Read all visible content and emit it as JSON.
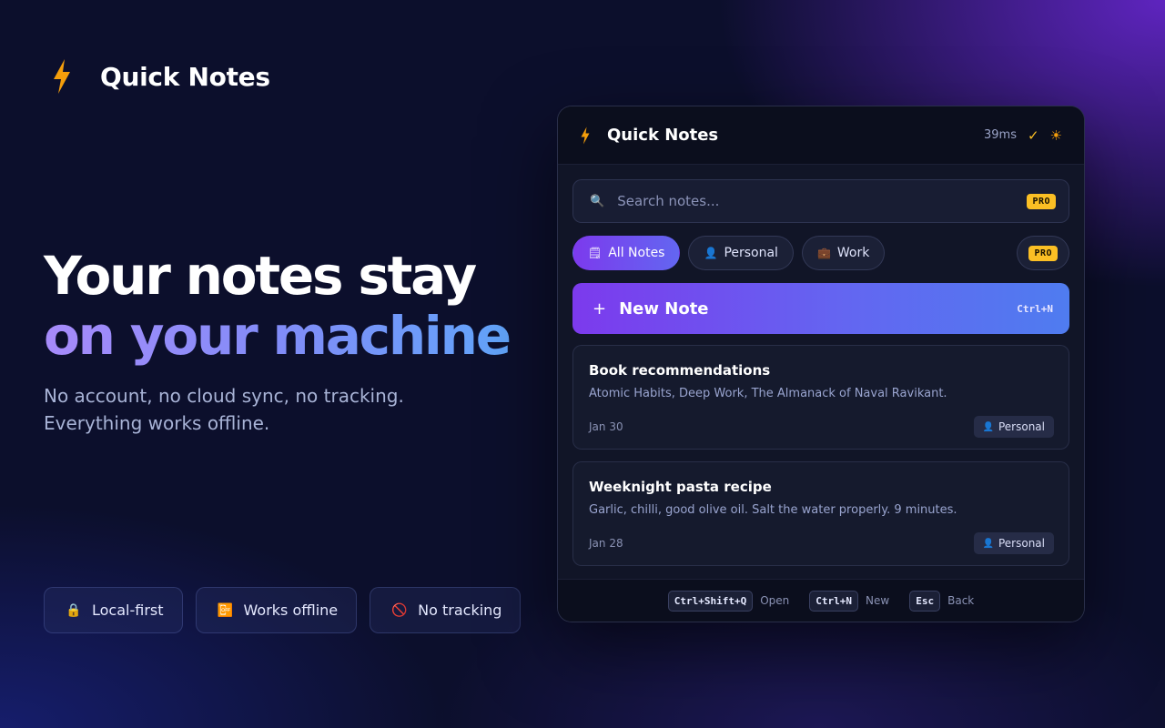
{
  "brand": {
    "name": "Quick Notes",
    "icon": "lightning-bolt-icon"
  },
  "hero": {
    "line1": "Your notes stay",
    "line2": "on your machine",
    "subtitle": "No account, no cloud sync, no tracking. Everything works offline."
  },
  "features": [
    {
      "icon": "lock-icon",
      "glyph": "🔒",
      "label": "Local-first"
    },
    {
      "icon": "offline-icon",
      "glyph": "📴",
      "label": "Works offline"
    },
    {
      "icon": "no-entry-icon",
      "glyph": "🚫",
      "label": "No tracking"
    }
  ],
  "app": {
    "title": "Quick Notes",
    "latency": "39ms",
    "check_glyph": "✓",
    "theme_glyph": "☀",
    "search": {
      "placeholder": "Search notes...",
      "badge": "PRO"
    },
    "filters": [
      {
        "glyph": "🗒",
        "label": "All Notes",
        "active": true
      },
      {
        "glyph": "👤",
        "label": "Personal",
        "active": false
      },
      {
        "glyph": "💼",
        "label": "Work",
        "active": false
      }
    ],
    "filter_pro_badge": "PRO",
    "new_note": {
      "plus": "+",
      "label": "New Note",
      "shortcut": "Ctrl+N"
    },
    "notes": [
      {
        "title": "Book recommendations",
        "body": "Atomic Habits, Deep Work, The Almanack of Naval Ravikant.",
        "date": "Jan 30",
        "tag": "Personal"
      },
      {
        "title": "Weeknight pasta recipe",
        "body": "Garlic, chilli, good olive oil. Salt the water properly. 9 minutes.",
        "date": "Jan 28",
        "tag": "Personal"
      }
    ],
    "shortcuts": [
      {
        "key": "Ctrl+Shift+Q",
        "label": "Open"
      },
      {
        "key": "Ctrl+N",
        "label": "New"
      },
      {
        "key": "Esc",
        "label": "Back"
      }
    ]
  },
  "colors": {
    "accent_purple": "#7c3aed",
    "accent_indigo": "#6366f1",
    "accent_blue": "#60a5fa",
    "pro_badge": "#fbbf24",
    "background": "#0c0f2c"
  }
}
